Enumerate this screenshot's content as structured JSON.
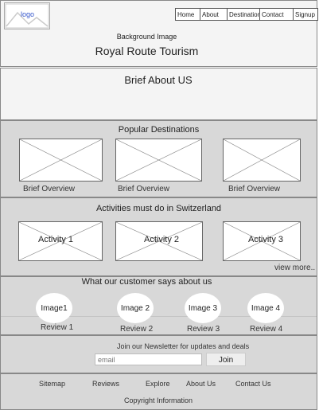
{
  "header": {
    "logo_label": "logo",
    "nav": [
      "Home",
      "About",
      "Destination",
      "Contact",
      "Signup"
    ],
    "subtitle": "Background Image",
    "title": "Royal Route Tourism"
  },
  "brief": {
    "title": "Brief About US"
  },
  "destinations": {
    "title": "Popular Destinations",
    "items": [
      "Brief Overview",
      "Brief Overview",
      "Brief Overview"
    ]
  },
  "activities": {
    "title": "Activities must do in Switzerland",
    "items": [
      "Activity 1",
      "Activity 2",
      "Activity 3"
    ],
    "view_more": "view more.."
  },
  "reviews": {
    "title": "What our customer says about us",
    "images": [
      "Image1",
      "Image 2",
      "Image 3",
      "Image 4"
    ],
    "labels": [
      "Review 1",
      "Review 2",
      "Review 3",
      "Review 4"
    ]
  },
  "newsletter": {
    "text": "Join our Newsletter for updates and deals",
    "placeholder": "email",
    "join_label": "Join"
  },
  "footer": {
    "links": [
      "Sitemap",
      "Reviews",
      "Explore",
      "About Us",
      "Contact Us"
    ],
    "copyright": "Copyright Information"
  }
}
